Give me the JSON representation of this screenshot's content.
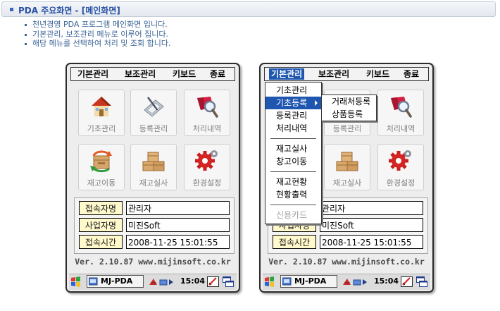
{
  "header": {
    "title": "PDA 주요화면 - [메인화면]"
  },
  "description": [
    "천년경영 PDA 프로그램 메인화면 입니다.",
    "기본관리, 보조관리 메뉴로 이루어 집니다.",
    "해당 메뉴를 선택하여 처리 및 조회 합니다."
  ],
  "menu": [
    "기본관리",
    "보조관리",
    "키보드",
    "종료"
  ],
  "tiles": [
    {
      "label": "기초관리",
      "icon": "house-icon"
    },
    {
      "label": "등록관리",
      "icon": "pda-pen-icon"
    },
    {
      "label": "처리내역",
      "icon": "magnifier-icon"
    },
    {
      "label": "재고이동",
      "icon": "boxes-arrows-icon"
    },
    {
      "label": "재고실사",
      "icon": "boxes-stack-icon"
    },
    {
      "label": "환경설정",
      "icon": "gear-icon"
    }
  ],
  "info": {
    "user_label": "접속자명",
    "user_value": "관리자",
    "company_label": "사업자명",
    "company_value": "미진Soft",
    "time_label": "접속시간",
    "time_value": "2008-11-25 15:01:55"
  },
  "version": "Ver. 2.10.87 www.mijinsoft.co.kr",
  "taskbar": {
    "app": "MJ-PDA",
    "time": "15:04"
  },
  "dropdown": {
    "items": [
      "기초관리",
      "기초등록",
      "등록관리",
      "처리내역",
      "재고실사",
      "창고이동",
      "재고현황",
      "현황출력",
      "신용카드"
    ],
    "active": "기초등록",
    "disabled": "신용카드",
    "submenu": [
      "거래처등록",
      "상품등록"
    ]
  },
  "colors": {
    "accent": "#1e56b0",
    "title": "#2a52a5",
    "label_bg": "#fff9cc"
  }
}
